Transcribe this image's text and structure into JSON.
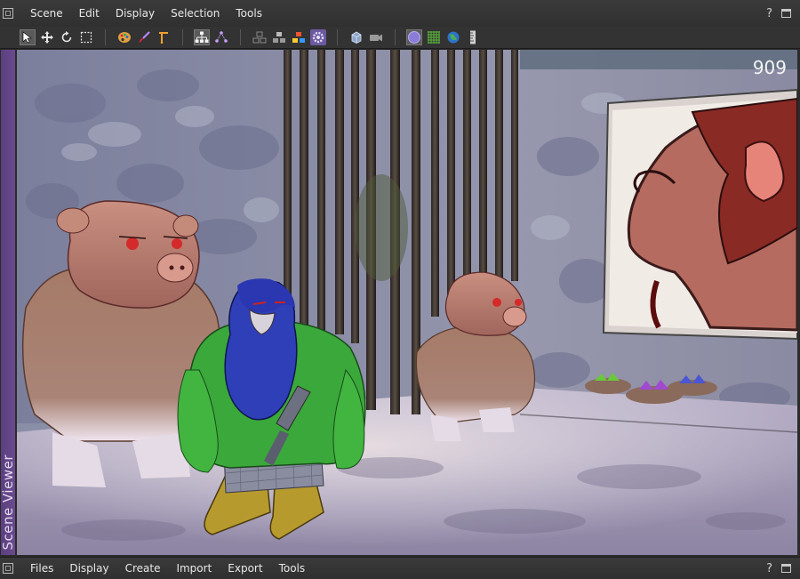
{
  "top_menu": {
    "items": [
      "Scene",
      "Edit",
      "Display",
      "Selection",
      "Tools"
    ],
    "help_label": "?"
  },
  "toolbar": {
    "groups": [
      [
        "select-arrow-icon",
        "move-icon",
        "rotate-icon",
        "marquee-select-icon"
      ],
      [
        "paint-palette-icon",
        "brush-icon",
        "joint-tool-icon"
      ],
      [
        "hierarchy-icon",
        "node-graph-icon"
      ],
      [
        "stack-gray-icon",
        "stack-dark-icon",
        "stack-color-icon",
        "settings-gear-icon"
      ],
      [
        "cube-icon",
        "camera-icon"
      ],
      [
        "sphere-shading-icon",
        "grid-icon",
        "globe-icon",
        "ruler-icon"
      ]
    ]
  },
  "side_panel": {
    "label": "Scene Viewer"
  },
  "viewport": {
    "frame_counter": "909"
  },
  "bottom_menu": {
    "items": [
      "Files",
      "Display",
      "Create",
      "Import",
      "Export",
      "Tools"
    ],
    "help_label": "?"
  },
  "colors": {
    "accent_purple": "#6a4a8f",
    "chrome_dark": "#2b2b2b",
    "highlight_tool": "#6b5aa0"
  }
}
